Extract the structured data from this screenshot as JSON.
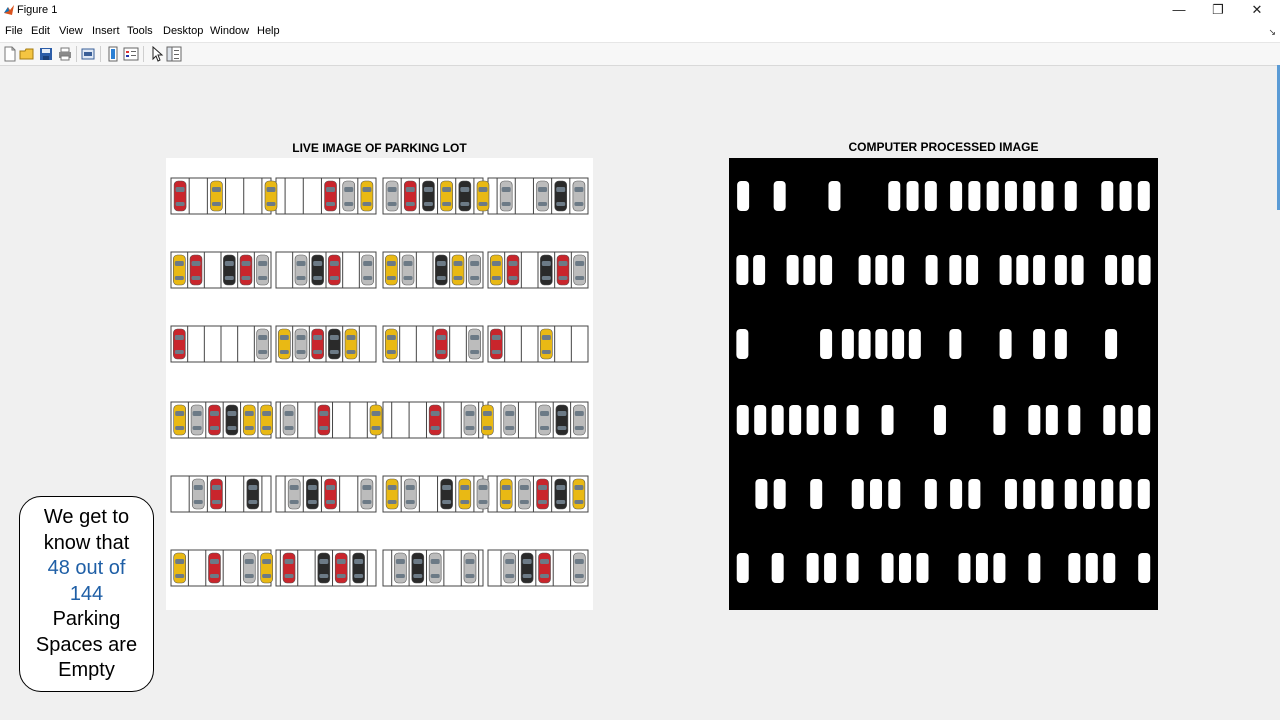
{
  "window": {
    "title": "Figure 1",
    "minimize_icon": "minimize-icon",
    "restore_icon": "restore-icon",
    "close_icon": "close-icon",
    "min_glyph": "—",
    "restore_glyph": "❐",
    "close_glyph": "✕"
  },
  "menu": {
    "items": [
      "File",
      "Edit",
      "View",
      "Insert",
      "Tools",
      "Desktop",
      "Window",
      "Help"
    ],
    "dock_glyph": "↘"
  },
  "toolbar": {
    "icons": [
      "new-figure-icon",
      "open-file-icon",
      "save-icon",
      "print-icon",
      "print-preview-icon",
      "colorbar-icon",
      "legend-icon",
      "pointer-icon",
      "property-inspector-icon"
    ]
  },
  "figure": {
    "left_title": "LIVE IMAGE OF PARKING LOT",
    "right_title": "COMPUTER PROCESSED IMAGE",
    "colors": {
      "yellow": "#e9b914",
      "red": "#c9252c",
      "black": "#2a2a2a",
      "gray": "#bcbcbc",
      "processed_bg": "#000000",
      "processed_car": "#ffffff"
    }
  },
  "parking_lot": {
    "rows": [
      [
        "red",
        "",
        "yellow",
        "",
        "",
        "yellow",
        "",
        "",
        "red",
        "gray",
        "yellow",
        "gray",
        "red",
        "black",
        "yellow",
        "black",
        "yellow",
        "gray",
        "",
        "gray",
        "black",
        "gray"
      ],
      [
        "yellow",
        "red",
        "",
        "black",
        "red",
        "gray",
        "",
        "gray",
        "black",
        "red",
        "",
        "gray",
        "yellow",
        "gray",
        "",
        "black",
        "yellow",
        "gray",
        "yellow",
        "red",
        "",
        "black",
        "red",
        "gray"
      ],
      [
        "red",
        "",
        "",
        "",
        "",
        "gray",
        "yellow",
        "gray",
        "red",
        "black",
        "yellow",
        "",
        "yellow",
        "",
        "",
        "red",
        "",
        "gray",
        "red",
        "",
        "",
        "yellow",
        "",
        ""
      ],
      [
        "yellow",
        "gray",
        "red",
        "black",
        "yellow",
        "yellow",
        "gray",
        "",
        "red",
        "",
        "",
        "yellow",
        "",
        "",
        "red",
        "",
        "gray",
        "yellow",
        "gray",
        "",
        "gray",
        "black",
        "gray"
      ],
      [
        "",
        "gray",
        "red",
        "",
        "black",
        "",
        "gray",
        "black",
        "red",
        "",
        "gray",
        "yellow",
        "gray",
        "",
        "black",
        "yellow",
        "gray",
        "yellow",
        "gray",
        "red",
        "black",
        "yellow"
      ],
      [
        "yellow",
        "",
        "red",
        "",
        "gray",
        "yellow",
        "red",
        "",
        "black",
        "red",
        "black",
        "",
        "gray",
        "black",
        "gray",
        "",
        "gray",
        "",
        "gray",
        "black",
        "red",
        "",
        "gray"
      ]
    ]
  },
  "callout": {
    "line1": "We get to",
    "line2": "know that",
    "line3": "48 out of",
    "line4": "144",
    "line5": "Parking",
    "line6": "Spaces are",
    "line7": "Empty"
  }
}
